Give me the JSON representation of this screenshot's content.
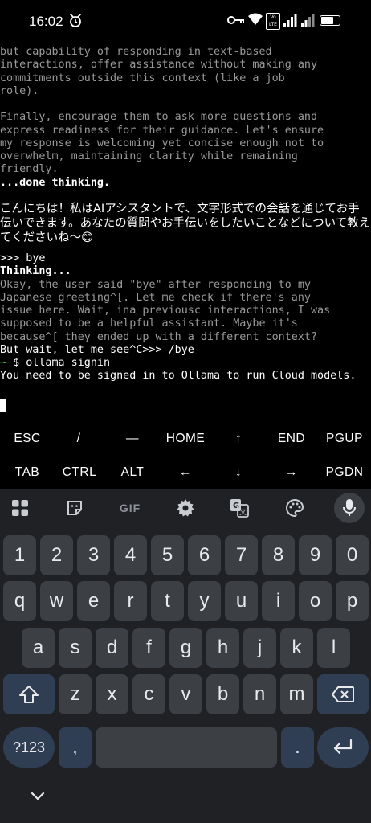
{
  "status_bar": {
    "time": "16:02",
    "lte_label": "LTE",
    "battery_level": 0.75
  },
  "terminal": {
    "lines_a": [
      "but capability of responding in text-based",
      "interactions, offer assistance without making any",
      "commitments outside this context (like a job",
      "role).",
      "",
      "Finally, encourage them to ask more questions and",
      "express readiness for their guidance. Let's ensure",
      "my response is welcoming yet concise enough not to",
      "overwhelm, maintaining clarity while remaining",
      "friendly."
    ],
    "done_thinking": "...done thinking.",
    "japanese_response": "こんにちは！私はAIアシスタントで、文字形式での会話を通じてお手伝いできます。あなたの質問やお手伝いをしたいことなどについて教えてくださいね〜😊",
    "prompt_bye": ">>> bye",
    "thinking": "Thinking...",
    "lines_b": [
      "Okay, the user said \"bye\" after responding to my",
      "Japanese greeting^[. Let me check if there's any",
      "issue here. Wait, ina previousc interactions, I was",
      "supposed to be a helpful assistant. Maybe it's",
      "because^[ they ended up with a different context?",
      "But wait, let me see^C>>> /bye"
    ],
    "prompt_tilde": "~",
    "command": " $ ollama signin",
    "signin_message": "You need to be signed in to Ollama to run Cloud models."
  },
  "extra_keys": {
    "row1": [
      "ESC",
      "/",
      "—",
      "HOME",
      "↑",
      "END",
      "PGUP"
    ],
    "row2": [
      "TAB",
      "CTRL",
      "ALT",
      "←",
      "↓",
      "→",
      "PGDN"
    ]
  },
  "keyboard": {
    "toolbar_gif": "GIF",
    "numbers": [
      "1",
      "2",
      "3",
      "4",
      "5",
      "6",
      "7",
      "8",
      "9",
      "0"
    ],
    "row_q": [
      "q",
      "w",
      "e",
      "r",
      "t",
      "y",
      "u",
      "i",
      "o",
      "p"
    ],
    "row_a": [
      "a",
      "s",
      "d",
      "f",
      "g",
      "h",
      "j",
      "k",
      "l"
    ],
    "row_z": [
      "z",
      "x",
      "c",
      "v",
      "b",
      "n",
      "m"
    ],
    "symbols_key": "?123",
    "comma_key": ",",
    "period_key": "."
  }
}
